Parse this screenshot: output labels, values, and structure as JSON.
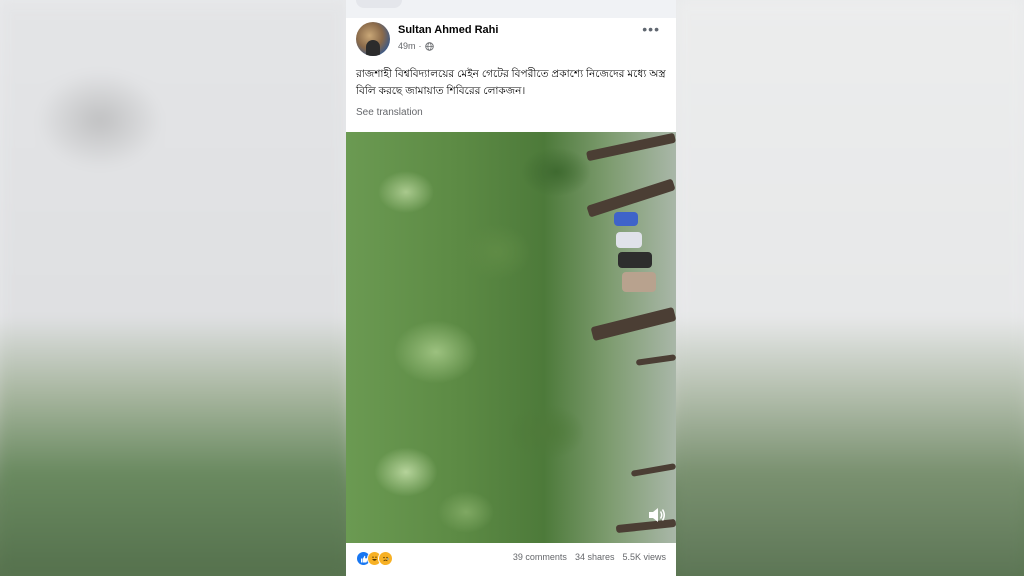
{
  "post": {
    "author": "Sultan Ahmed Rahi",
    "time": "49m",
    "separator": "·",
    "text": "রাজশাহী বিশ্ববিদ্যালয়ের মেইন গেটের বিপরীতে প্রকাশ্যে নিজেদের মধ্যে অস্ত্র বিলি করছে জামায়াত শিবিরের লোকজন।",
    "see_translation": "See translation",
    "more_icon": "more-options-icon",
    "privacy_icon": "globe-icon"
  },
  "video": {
    "sound_icon": "volume-icon"
  },
  "footer": {
    "reactions": [
      "like-icon",
      "haha-icon",
      "sad-icon"
    ],
    "comments": "39 comments",
    "shares": "34 shares",
    "views": "5.5K views"
  },
  "colors": {
    "like": "#1877f2",
    "meta_text": "#65676b",
    "author_text": "#050505"
  }
}
